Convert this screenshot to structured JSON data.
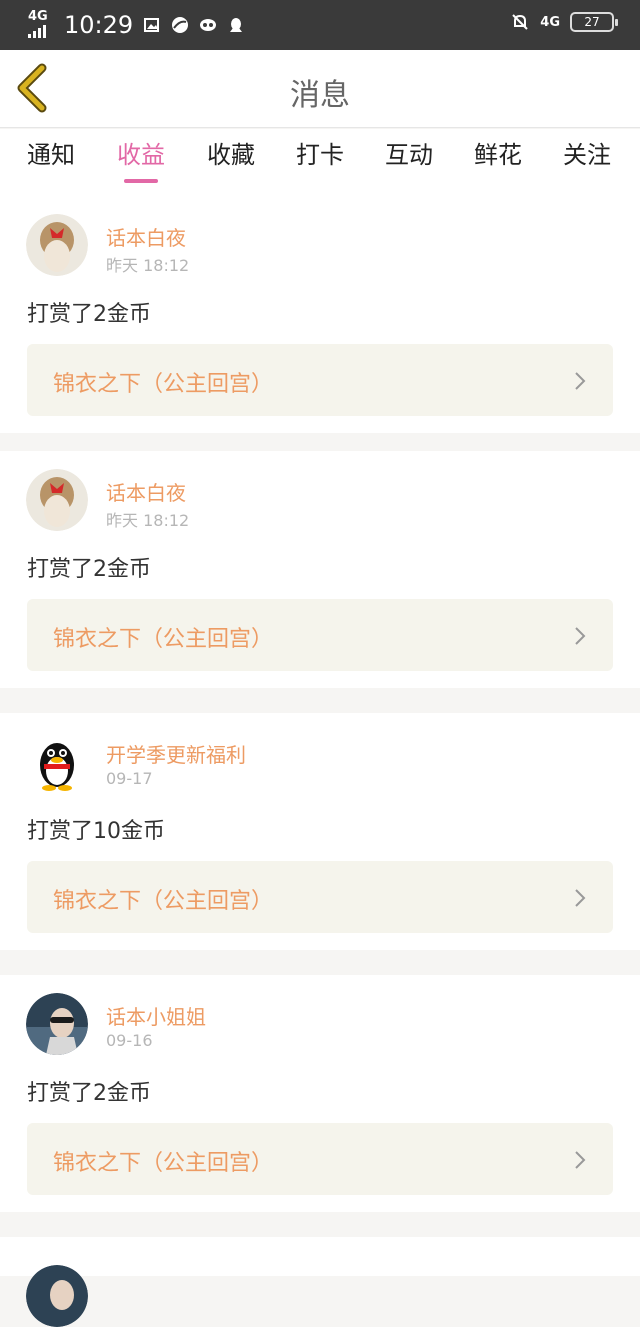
{
  "status_bar": {
    "network_left": "4G",
    "time": "10:29",
    "network_right": "4G",
    "battery": "27",
    "icons": [
      "gallery-icon",
      "browser-icon",
      "mask-icon",
      "qq-icon",
      "mute-bell-icon"
    ]
  },
  "header": {
    "title": "消息",
    "back_icon": "chevron-left-icon",
    "back_color": "#d9b320"
  },
  "tabs": [
    {
      "label": "通知",
      "active": false
    },
    {
      "label": "收益",
      "active": true
    },
    {
      "label": "收藏",
      "active": false
    },
    {
      "label": "打卡",
      "active": false
    },
    {
      "label": "互动",
      "active": false
    },
    {
      "label": "鲜花",
      "active": false
    },
    {
      "label": "关注",
      "active": false
    }
  ],
  "accent_color": "#e268a6",
  "name_color": "#ed9b63",
  "messages": [
    {
      "name": "话本白夜",
      "time": "昨天 18:12",
      "text": "打赏了2金币",
      "book": "锦衣之下（公主回宫）",
      "avatar": "doll-avatar"
    },
    {
      "name": "话本白夜",
      "time": "昨天 18:12",
      "text": "打赏了2金币",
      "book": "锦衣之下（公主回宫）",
      "avatar": "doll-avatar"
    },
    {
      "name": "开学季更新福利",
      "time": "09-17",
      "text": "打赏了10金币",
      "book": "锦衣之下（公主回宫）",
      "avatar": "penguin-avatar"
    },
    {
      "name": "话本小姐姐",
      "time": "09-16",
      "text": "打赏了2金币",
      "book": "锦衣之下（公主回宫）",
      "avatar": "person-avatar"
    }
  ]
}
